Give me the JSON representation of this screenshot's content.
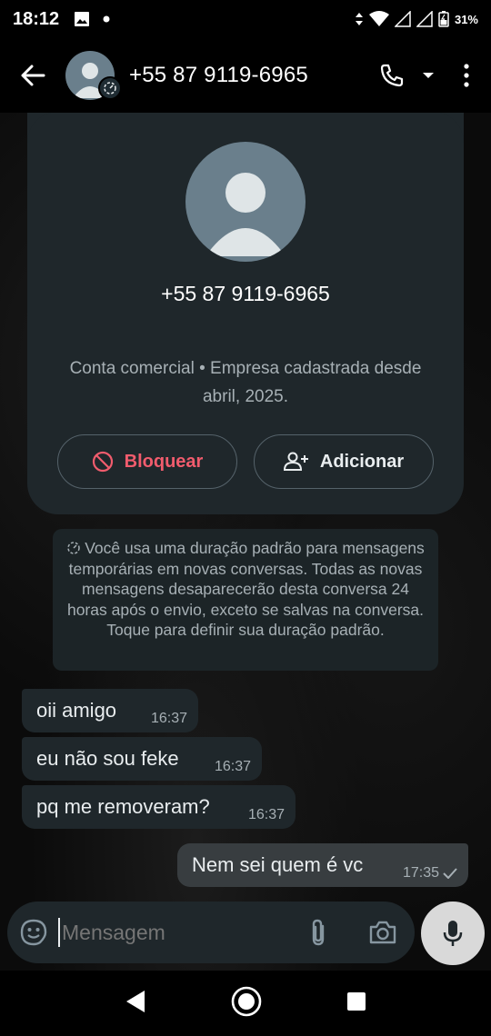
{
  "status_bar": {
    "time": "18:12",
    "battery": "31%"
  },
  "header": {
    "title": "+55 87 9119-6965"
  },
  "contact_card": {
    "phone": "+55 87 9119-6965",
    "subtitle": "Conta comercial • Empresa cadastrada desde abril, 2025.",
    "block_label": "Bloquear",
    "add_label": "Adicionar"
  },
  "notice": {
    "text": "Você usa uma duração padrão para mensagens temporárias em novas conversas. Todas as novas mensagens desaparecerão desta conversa 24 horas após o envio, exceto se salvas na conversa. Toque para definir sua duração padrão."
  },
  "messages": [
    {
      "text": "oii amigo",
      "time": "16:37",
      "direction": "in"
    },
    {
      "text": "eu não sou feke",
      "time": "16:37",
      "direction": "in"
    },
    {
      "text": "pq me removeram?",
      "time": "16:37",
      "direction": "in"
    },
    {
      "text": "Nem sei quem é vc",
      "time": "17:35",
      "direction": "out"
    }
  ],
  "composer": {
    "placeholder": "Mensagem"
  },
  "colors": {
    "accent_red": "#f15c6d",
    "bubble_in": "#1f272b",
    "bubble_out": "#383d40"
  },
  "icons": [
    "back-arrow-icon",
    "timer-icon",
    "phone-icon",
    "dropdown-icon",
    "more-vert-icon",
    "block-icon",
    "add-person-icon",
    "sticker-icon",
    "attach-icon",
    "camera-icon",
    "mic-icon",
    "nav-back-icon",
    "nav-home-icon",
    "nav-recents-icon"
  ]
}
